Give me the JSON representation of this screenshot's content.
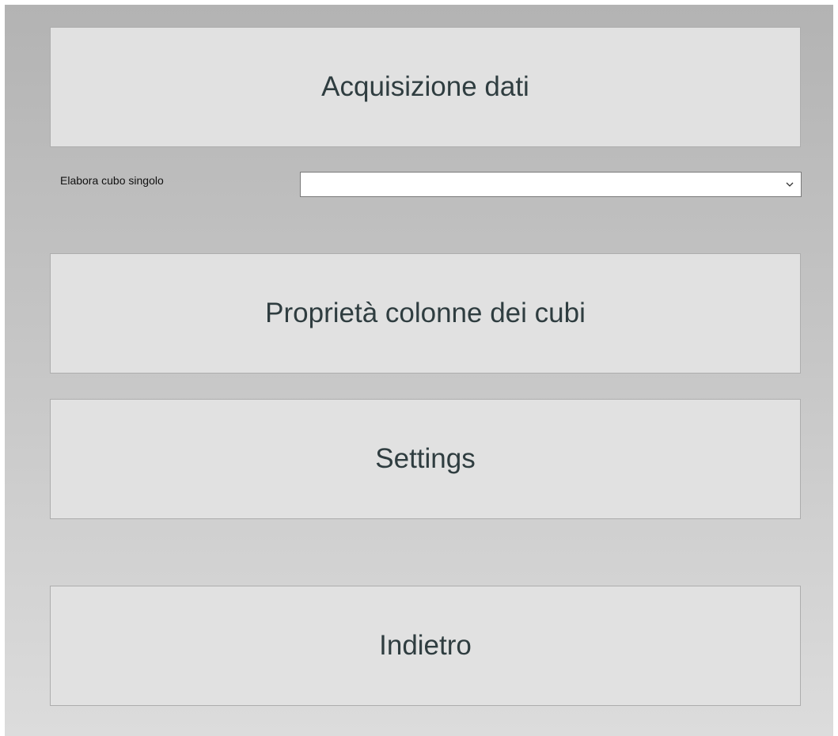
{
  "buttons": {
    "acquisizione": "Acquisizione dati",
    "proprieta": "Proprietà colonne dei cubi",
    "settings": "Settings",
    "indietro": "Indietro"
  },
  "single_cube": {
    "label": "Elabora cubo singolo",
    "selected_value": ""
  },
  "icons": {
    "dropdown": "chevron-down-icon"
  },
  "colors": {
    "button_bg": "#e1e1e1",
    "button_text": "#2f3d40",
    "panel_top": "#b3b3b3",
    "panel_bottom": "#dcdcdc"
  }
}
